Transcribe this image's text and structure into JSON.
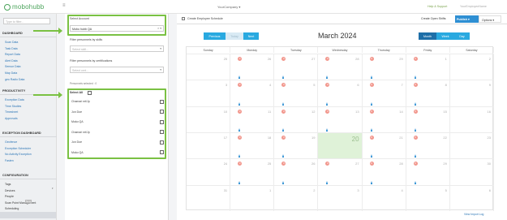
{
  "app": {
    "logo": "mobohubb",
    "company": "YourCompany ▾",
    "help": "Help & Support",
    "user": "YourEmployeeName"
  },
  "sidebar": {
    "search_placeholder": "Type to filter...",
    "sections": [
      {
        "title": "DASHBOARD",
        "items": [
          "Scan Data",
          "Task Data",
          "Report Data",
          "Alert Data",
          "Sensor Data",
          "Map Data",
          "geo Radio Data"
        ]
      },
      {
        "title": "PRODUCTIVITY",
        "items": [
          "Exception Data",
          "Time Studies",
          "Timesheet",
          "Approvals"
        ]
      },
      {
        "title": "EXCEPTION DASHBOARD",
        "items": [
          "Geofence",
          "Exception Scheduler",
          "No Activity Exception",
          "Fasten"
        ]
      },
      {
        "title": "CONFIGURATION",
        "items": [
          "Tags",
          "Devices",
          "People",
          "Scan Point Management",
          "Scheduling"
        ]
      }
    ],
    "scheduling_tag": "New"
  },
  "filters": {
    "account_label": "Select Account",
    "account_value": "Mobo hubb QA",
    "skills_label": "Filter personnels by skills",
    "skills_placeholder": "Select skill...",
    "cert_label": "Filter personnels by certifications",
    "cert_placeholder": "Select cert...",
    "selected_count": "Personnels selected : 0",
    "select_all": "Select All",
    "people": [
      "Chamari mt/Jp",
      "Jon Doe",
      "Moko QA",
      "Chamari mt/Jp",
      "Jon Doe",
      "Moko QA"
    ]
  },
  "toolbar": {
    "title": "Create Employee Schedule",
    "open_shifts": "Create Open Shifts",
    "publish": "Publish ▾",
    "options": "Options ▾"
  },
  "calendar": {
    "prev": "Previous",
    "today": "Today",
    "next": "Next",
    "title": "March 2024",
    "views": [
      "Month",
      "Week",
      "Day"
    ],
    "days": [
      "Sunday",
      "Monday",
      "Tuesday",
      "Wednesday",
      "Thursday",
      "Friday",
      "Saturday"
    ],
    "weeks": [
      [
        {
          "d": "25",
          "b": "",
          "p": false
        },
        {
          "d": "26",
          "b": "0",
          "p": true
        },
        {
          "d": "27",
          "b": "0",
          "p": true
        },
        {
          "d": "28",
          "b": "0",
          "p": true
        },
        {
          "d": "29",
          "b": "0",
          "p": true
        },
        {
          "d": "1",
          "b": "0",
          "p": true
        },
        {
          "d": "2",
          "b": "",
          "p": false
        }
      ],
      [
        {
          "d": "3",
          "b": "",
          "p": false
        },
        {
          "d": "4",
          "b": "0",
          "p": true
        },
        {
          "d": "5",
          "b": "0",
          "p": true
        },
        {
          "d": "6",
          "b": "0",
          "p": true
        },
        {
          "d": "7",
          "b": "0",
          "p": true
        },
        {
          "d": "8",
          "b": "0",
          "p": true
        },
        {
          "d": "9",
          "b": "",
          "p": false
        }
      ],
      [
        {
          "d": "10",
          "b": "",
          "p": false
        },
        {
          "d": "11",
          "b": "0",
          "p": true
        },
        {
          "d": "12",
          "b": "0",
          "p": true
        },
        {
          "d": "13",
          "b": "0",
          "p": true
        },
        {
          "d": "14",
          "b": "0",
          "p": true
        },
        {
          "d": "15",
          "b": "0",
          "p": true
        },
        {
          "d": "16",
          "b": "",
          "p": false
        }
      ],
      [
        {
          "d": "17",
          "b": "",
          "p": false
        },
        {
          "d": "18",
          "b": "0",
          "p": true
        },
        {
          "d": "19",
          "b": "0",
          "p": true
        },
        {
          "d": "20",
          "b": "",
          "p": false
        },
        {
          "d": "21",
          "b": "0",
          "p": true
        },
        {
          "d": "22",
          "b": "0",
          "p": true
        },
        {
          "d": "23",
          "b": "",
          "p": false
        }
      ],
      [
        {
          "d": "24",
          "b": "",
          "p": false
        },
        {
          "d": "25",
          "b": "0",
          "p": true
        },
        {
          "d": "26",
          "b": "0",
          "p": true
        },
        {
          "d": "27",
          "b": "0",
          "p": true
        },
        {
          "d": "28",
          "b": "0",
          "p": true
        },
        {
          "d": "29",
          "b": "0",
          "p": true
        },
        {
          "d": "30",
          "b": "",
          "p": false
        }
      ],
      [
        {
          "d": "31",
          "b": "",
          "p": false
        },
        {
          "d": "1",
          "b": "",
          "p": false
        },
        {
          "d": "2",
          "b": "",
          "p": false
        },
        {
          "d": "3",
          "b": "",
          "p": false
        },
        {
          "d": "4",
          "b": "",
          "p": false
        },
        {
          "d": "5",
          "b": "",
          "p": false
        },
        {
          "d": "6",
          "b": "",
          "p": false
        }
      ]
    ],
    "today_day": "20",
    "footer_link": "View Import Log"
  },
  "colors": {
    "accent": "#29a9e0",
    "highlight": "#7ac143",
    "today": "#dff2d8"
  }
}
